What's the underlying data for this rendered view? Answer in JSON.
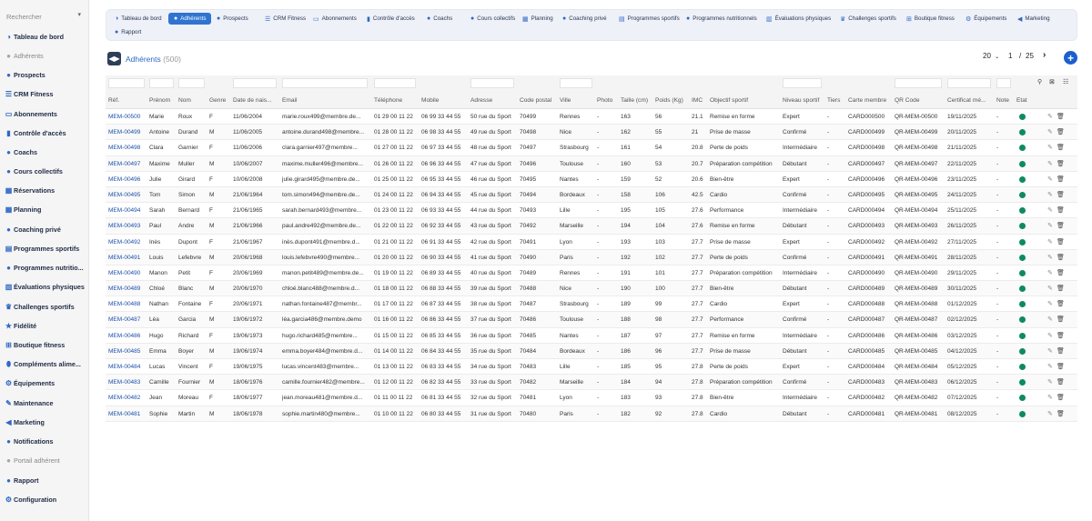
{
  "sidebar": {
    "search_placeholder": "Rechercher",
    "items": [
      {
        "label": "Tableau de bord",
        "icon": "dashboard-icon",
        "glyph": "◑",
        "muted": false
      },
      {
        "label": "Adhérents",
        "icon": "user-icon",
        "glyph": "●",
        "muted": true
      },
      {
        "label": "Prospects",
        "icon": "user-plus-icon",
        "glyph": "●",
        "muted": false
      },
      {
        "label": "CRM Fitness",
        "icon": "list-icon",
        "glyph": "☰",
        "muted": false
      },
      {
        "label": "Abonnements",
        "icon": "id-card-icon",
        "glyph": "▭",
        "muted": false
      },
      {
        "label": "Contrôle d'accès",
        "icon": "door-icon",
        "glyph": "▮",
        "muted": false
      },
      {
        "label": "Coachs",
        "icon": "coach-icon",
        "glyph": "●",
        "muted": false
      },
      {
        "label": "Cours collectifs",
        "icon": "group-icon",
        "glyph": "●",
        "muted": false
      },
      {
        "label": "Réservations",
        "icon": "calendar-check-icon",
        "glyph": "▦",
        "muted": false
      },
      {
        "label": "Planning",
        "icon": "calendar-icon",
        "glyph": "▦",
        "muted": false
      },
      {
        "label": "Coaching privé",
        "icon": "private-coach-icon",
        "glyph": "●",
        "muted": false
      },
      {
        "label": "Programmes sportifs",
        "icon": "clipboard-icon",
        "glyph": "▤",
        "muted": false
      },
      {
        "label": "Programmes nutritio...",
        "icon": "apple-icon",
        "glyph": "●",
        "muted": false
      },
      {
        "label": "Évaluations physiques",
        "icon": "chart-icon",
        "glyph": "▥",
        "muted": false
      },
      {
        "label": "Challenges sportifs",
        "icon": "trophy-icon",
        "glyph": "♛",
        "muted": false
      },
      {
        "label": "Fidélité",
        "icon": "star-icon",
        "glyph": "★",
        "muted": false
      },
      {
        "label": "Boutique fitness",
        "icon": "cart-icon",
        "glyph": "⊞",
        "muted": false
      },
      {
        "label": "Compléments alime...",
        "icon": "pill-icon",
        "glyph": "⬮",
        "muted": false
      },
      {
        "label": "Équipements",
        "icon": "dumbbell-icon",
        "glyph": "⚙",
        "muted": false
      },
      {
        "label": "Maintenance",
        "icon": "wrench-icon",
        "glyph": "✎",
        "muted": false
      },
      {
        "label": "Marketing",
        "icon": "megaphone-icon",
        "glyph": "◀",
        "muted": false
      },
      {
        "label": "Notifications",
        "icon": "bell-icon",
        "glyph": "●",
        "muted": false
      },
      {
        "label": "Portail adhérent",
        "icon": "portal-icon",
        "glyph": "●",
        "muted": true
      },
      {
        "label": "Rapport",
        "icon": "report-icon",
        "glyph": "●",
        "muted": false
      },
      {
        "label": "Configuration",
        "icon": "gear-icon",
        "glyph": "⚙",
        "muted": false
      }
    ]
  },
  "nav": {
    "tabs": [
      {
        "label": "Tableau de bord",
        "icon": "dashboard-icon",
        "glyph": "◑",
        "active": false
      },
      {
        "label": "Adhérents",
        "icon": "user-icon",
        "glyph": "●",
        "active": true
      },
      {
        "label": "Prospects",
        "icon": "user-plus-icon",
        "glyph": "●",
        "active": false
      },
      {
        "label": "CRM Fitness",
        "icon": "list-icon",
        "glyph": "☰",
        "active": false
      },
      {
        "label": "Abonnements",
        "icon": "id-card-icon",
        "glyph": "▭",
        "active": false
      },
      {
        "label": "Contrôle d'accès",
        "icon": "door-icon",
        "glyph": "▮",
        "active": false
      },
      {
        "label": "Coachs",
        "icon": "coach-icon",
        "glyph": "●",
        "active": false
      },
      {
        "label": "Cours collectifs",
        "icon": "group-icon",
        "glyph": "●",
        "active": false
      },
      {
        "label": "Planning",
        "icon": "calendar-icon",
        "glyph": "▦",
        "active": false
      },
      {
        "label": "Coaching privé",
        "icon": "private-coach-icon",
        "glyph": "●",
        "active": false
      },
      {
        "label": "Programmes sportifs",
        "icon": "clipboard-icon",
        "glyph": "▤",
        "active": false
      },
      {
        "label": "Programmes nutritionnels",
        "icon": "apple-icon",
        "glyph": "●",
        "active": false
      },
      {
        "label": "Évaluations physiques",
        "icon": "chart-icon",
        "glyph": "▥",
        "active": false
      },
      {
        "label": "Challenges sportifs",
        "icon": "trophy-icon",
        "glyph": "♛",
        "active": false
      },
      {
        "label": "Boutique fitness",
        "icon": "cart-icon",
        "glyph": "⊞",
        "active": false
      },
      {
        "label": "Équipements",
        "icon": "dumbbell-icon",
        "glyph": "⚙",
        "active": false
      },
      {
        "label": "Marketing",
        "icon": "megaphone-icon",
        "glyph": "◀",
        "active": false
      },
      {
        "label": "Rapport",
        "icon": "report-icon",
        "glyph": "●",
        "active": false
      }
    ]
  },
  "page": {
    "title": "Adhérents",
    "count": "(500)",
    "per_page": "20",
    "current_page": "1",
    "page_sep": "/",
    "total_pages": "25"
  },
  "colors": {
    "accent": "#2f74d0",
    "status_active": "#0f8a5f",
    "ref_link": "#1b4fa8"
  },
  "columns": [
    "Réf.",
    "Prénom",
    "Nom",
    "Genre",
    "Date de nais...",
    "Email",
    "Téléphone",
    "Mobile",
    "Adresse",
    "Code postal",
    "Ville",
    "Photo",
    "Taille (cm)",
    "Poids (Kg)",
    "IMC",
    "Objectif sportif",
    "Niveau sportif",
    "Tiers",
    "Carte membre",
    "QR Code",
    "Certificat mé...",
    "Note",
    "État"
  ],
  "rows": [
    [
      "MEM-00500",
      "Marie",
      "Roux",
      "F",
      "11/06/2004",
      "marie.roux499@membre.de...",
      "01 29 00 11 22",
      "06 99 33 44 55",
      "50 rue du Sport",
      "70499",
      "Rennes",
      "-",
      "163",
      "56",
      "21.1",
      "Remise en forme",
      "Expert",
      "-",
      "CARD000500",
      "QR-MEM-00500",
      "19/11/2025",
      "-"
    ],
    [
      "MEM-00499",
      "Antoine",
      "Durand",
      "M",
      "11/06/2005",
      "antoine.durand498@membre...",
      "01 28 00 11 22",
      "06 98 33 44 55",
      "49 rue du Sport",
      "70498",
      "Nice",
      "-",
      "162",
      "55",
      "21",
      "Prise de masse",
      "Confirmé",
      "-",
      "CARD000499",
      "QR-MEM-00499",
      "20/11/2025",
      "-"
    ],
    [
      "MEM-00498",
      "Clara",
      "Garnier",
      "F",
      "11/06/2006",
      "clara.garnier497@membre...",
      "01 27 00 11 22",
      "06 97 33 44 55",
      "48 rue du Sport",
      "70497",
      "Strasbourg",
      "-",
      "161",
      "54",
      "20.8",
      "Perte de poids",
      "Intermédiaire",
      "-",
      "CARD000498",
      "QR-MEM-00498",
      "21/11/2025",
      "-"
    ],
    [
      "MEM-00497",
      "Maxime",
      "Muller",
      "M",
      "10/06/2007",
      "maxime.muller496@membre...",
      "01 26 00 11 22",
      "06 96 33 44 55",
      "47 rue du Sport",
      "70496",
      "Toulouse",
      "-",
      "160",
      "53",
      "20.7",
      "Préparation compétition",
      "Débutant",
      "-",
      "CARD000497",
      "QR-MEM-00497",
      "22/11/2025",
      "-"
    ],
    [
      "MEM-00496",
      "Julie",
      "Girard",
      "F",
      "10/06/2008",
      "julie.girard495@membre.de...",
      "01 25 00 11 22",
      "06 95 33 44 55",
      "46 rue du Sport",
      "70495",
      "Nantes",
      "-",
      "159",
      "52",
      "20.6",
      "Bien-être",
      "Expert",
      "-",
      "CARD000496",
      "QR-MEM-00496",
      "23/11/2025",
      "-"
    ],
    [
      "MEM-00495",
      "Tom",
      "Simon",
      "M",
      "21/06/1964",
      "tom.simon494@membre.de...",
      "01 24 00 11 22",
      "06 94 33 44 55",
      "45 rue du Sport",
      "70494",
      "Bordeaux",
      "-",
      "158",
      "106",
      "42.5",
      "Cardio",
      "Confirmé",
      "-",
      "CARD000495",
      "QR-MEM-00495",
      "24/11/2025",
      "-"
    ],
    [
      "MEM-00494",
      "Sarah",
      "Bernard",
      "F",
      "21/06/1965",
      "sarah.bernard493@membre...",
      "01 23 00 11 22",
      "06 93 33 44 55",
      "44 rue du Sport",
      "70493",
      "Lille",
      "-",
      "195",
      "105",
      "27.6",
      "Performance",
      "Intermédiaire",
      "-",
      "CARD000494",
      "QR-MEM-00494",
      "25/11/2025",
      "-"
    ],
    [
      "MEM-00493",
      "Paul",
      "Andre",
      "M",
      "21/06/1966",
      "paul.andre492@membre.de...",
      "01 22 00 11 22",
      "06 92 33 44 55",
      "43 rue du Sport",
      "70492",
      "Marseille",
      "-",
      "194",
      "104",
      "27.6",
      "Remise en forme",
      "Débutant",
      "-",
      "CARD000493",
      "QR-MEM-00493",
      "26/11/2025",
      "-"
    ],
    [
      "MEM-00492",
      "Inès",
      "Dupont",
      "F",
      "21/06/1967",
      "inès.dupont491@membre.d...",
      "01 21 00 11 22",
      "06 91 33 44 55",
      "42 rue du Sport",
      "70491",
      "Lyon",
      "-",
      "193",
      "103",
      "27.7",
      "Prise de masse",
      "Expert",
      "-",
      "CARD000492",
      "QR-MEM-00492",
      "27/11/2025",
      "-"
    ],
    [
      "MEM-00491",
      "Louis",
      "Lefebvre",
      "M",
      "20/06/1968",
      "louis.lefebvre490@membre...",
      "01 20 00 11 22",
      "06 90 33 44 55",
      "41 rue du Sport",
      "70490",
      "Paris",
      "-",
      "192",
      "102",
      "27.7",
      "Perte de poids",
      "Confirmé",
      "-",
      "CARD000491",
      "QR-MEM-00491",
      "28/11/2025",
      "-"
    ],
    [
      "MEM-00490",
      "Manon",
      "Petit",
      "F",
      "20/06/1969",
      "manon.petit489@membre.de...",
      "01 19 00 11 22",
      "06 89 33 44 55",
      "40 rue du Sport",
      "70489",
      "Rennes",
      "-",
      "191",
      "101",
      "27.7",
      "Préparation compétition",
      "Intermédiaire",
      "-",
      "CARD000490",
      "QR-MEM-00490",
      "29/11/2025",
      "-"
    ],
    [
      "MEM-00489",
      "Chloé",
      "Blanc",
      "M",
      "20/06/1970",
      "chloé.blanc488@membre.d...",
      "01 18 00 11 22",
      "06 88 33 44 55",
      "39 rue du Sport",
      "70488",
      "Nice",
      "-",
      "190",
      "100",
      "27.7",
      "Bien-être",
      "Débutant",
      "-",
      "CARD000489",
      "QR-MEM-00489",
      "30/11/2025",
      "-"
    ],
    [
      "MEM-00488",
      "Nathan",
      "Fontaine",
      "F",
      "20/06/1971",
      "nathan.fontaine487@membr...",
      "01 17 00 11 22",
      "06 87 33 44 55",
      "38 rue du Sport",
      "70487",
      "Strasbourg",
      "-",
      "189",
      "99",
      "27.7",
      "Cardio",
      "Expert",
      "-",
      "CARD000488",
      "QR-MEM-00488",
      "01/12/2025",
      "-"
    ],
    [
      "MEM-00487",
      "Léa",
      "Garcia",
      "M",
      "19/06/1972",
      "léa.garcia486@membre.demo",
      "01 16 00 11 22",
      "06 86 33 44 55",
      "37 rue du Sport",
      "70486",
      "Toulouse",
      "-",
      "188",
      "98",
      "27.7",
      "Performance",
      "Confirmé",
      "-",
      "CARD000487",
      "QR-MEM-00487",
      "02/12/2025",
      "-"
    ],
    [
      "MEM-00486",
      "Hugo",
      "Richard",
      "F",
      "19/06/1973",
      "hugo.richard485@membre...",
      "01 15 00 11 22",
      "06 85 33 44 55",
      "36 rue du Sport",
      "70485",
      "Nantes",
      "-",
      "187",
      "97",
      "27.7",
      "Remise en forme",
      "Intermédiaire",
      "-",
      "CARD000486",
      "QR-MEM-00486",
      "03/12/2025",
      "-"
    ],
    [
      "MEM-00485",
      "Emma",
      "Boyer",
      "M",
      "19/06/1974",
      "emma.boyer484@membre.d...",
      "01 14 00 11 22",
      "06 84 33 44 55",
      "35 rue du Sport",
      "70484",
      "Bordeaux",
      "-",
      "186",
      "96",
      "27.7",
      "Prise de masse",
      "Débutant",
      "-",
      "CARD000485",
      "QR-MEM-00485",
      "04/12/2025",
      "-"
    ],
    [
      "MEM-00484",
      "Lucas",
      "Vincent",
      "F",
      "19/06/1975",
      "lucas.vincent483@membre...",
      "01 13 00 11 22",
      "06 83 33 44 55",
      "34 rue du Sport",
      "70483",
      "Lille",
      "-",
      "185",
      "95",
      "27.8",
      "Perte de poids",
      "Expert",
      "-",
      "CARD000484",
      "QR-MEM-00484",
      "05/12/2025",
      "-"
    ],
    [
      "MEM-00483",
      "Camille",
      "Fournier",
      "M",
      "18/06/1976",
      "camille.fournier482@membre...",
      "01 12 00 11 22",
      "06 82 33 44 55",
      "33 rue du Sport",
      "70482",
      "Marseille",
      "-",
      "184",
      "94",
      "27.8",
      "Préparation compétition",
      "Confirmé",
      "-",
      "CARD000483",
      "QR-MEM-00483",
      "06/12/2025",
      "-"
    ],
    [
      "MEM-00482",
      "Jean",
      "Moreau",
      "F",
      "18/06/1977",
      "jean.moreau481@membre.d...",
      "01 11 00 11 22",
      "06 81 33 44 55",
      "32 rue du Sport",
      "70481",
      "Lyon",
      "-",
      "183",
      "93",
      "27.8",
      "Bien-être",
      "Intermédiaire",
      "-",
      "CARD000482",
      "QR-MEM-00482",
      "07/12/2025",
      "-"
    ],
    [
      "MEM-00481",
      "Sophie",
      "Martin",
      "M",
      "18/06/1978",
      "sophie.martin480@membre...",
      "01 10 00 11 22",
      "06 80 33 44 55",
      "31 rue du Sport",
      "70480",
      "Paris",
      "-",
      "182",
      "92",
      "27.8",
      "Cardio",
      "Débutant",
      "-",
      "CARD000481",
      "QR-MEM-00481",
      "08/12/2025",
      "-"
    ]
  ]
}
